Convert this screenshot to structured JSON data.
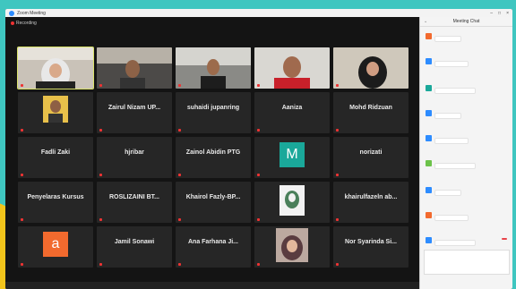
{
  "window": {
    "title": "Zoom Meeting"
  },
  "recording": {
    "label": "Recording"
  },
  "chat": {
    "title": "Meeting Chat"
  },
  "tiles": [
    {
      "name": "",
      "sub": "",
      "photo": "woman-hijab"
    },
    {
      "name": "",
      "sub": "",
      "photo": "man-glasses"
    },
    {
      "name": "",
      "sub": "",
      "photo": "man-beard"
    },
    {
      "name": "",
      "sub": "",
      "photo": "man-red"
    },
    {
      "name": "",
      "sub": "",
      "photo": "woman-hijab-dark"
    },
    {
      "name": "",
      "sub": "",
      "photo": "man-small"
    },
    {
      "name": "Zairul Nizam UP...",
      "sub": ""
    },
    {
      "name": "suhaidi jupanring",
      "sub": ""
    },
    {
      "name": "Aaniza",
      "sub": ""
    },
    {
      "name": "Mohd Ridzuan",
      "sub": ""
    },
    {
      "name": "Fadli Zaki",
      "sub": ""
    },
    {
      "name": "hjribar",
      "sub": ""
    },
    {
      "name": "Zainol Abidin PTG",
      "sub": ""
    },
    {
      "name": "",
      "sub": "",
      "letter": "M",
      "color": "#1aa89a"
    },
    {
      "name": "norizati",
      "sub": ""
    },
    {
      "name": "Penyelaras Kursus",
      "sub": ""
    },
    {
      "name": "ROSLIZAINI BT...",
      "sub": ""
    },
    {
      "name": "Khairol  Fazly-BP...",
      "sub": ""
    },
    {
      "name": "",
      "sub": "",
      "photo": "hijab-icon"
    },
    {
      "name": "khairulfazeln  ab...",
      "sub": ""
    },
    {
      "name": "",
      "sub": "",
      "letter": "a",
      "color": "#f26a2e"
    },
    {
      "name": "Jamil Sonawi",
      "sub": ""
    },
    {
      "name": "Ana Farhana Ji...",
      "sub": ""
    },
    {
      "name": "",
      "sub": "",
      "photo": "woman-hijab-2"
    },
    {
      "name": "Nor Syarinda Si...",
      "sub": ""
    }
  ],
  "colors": {
    "accent": "#2d8cff",
    "background": "#3fc6c0"
  }
}
